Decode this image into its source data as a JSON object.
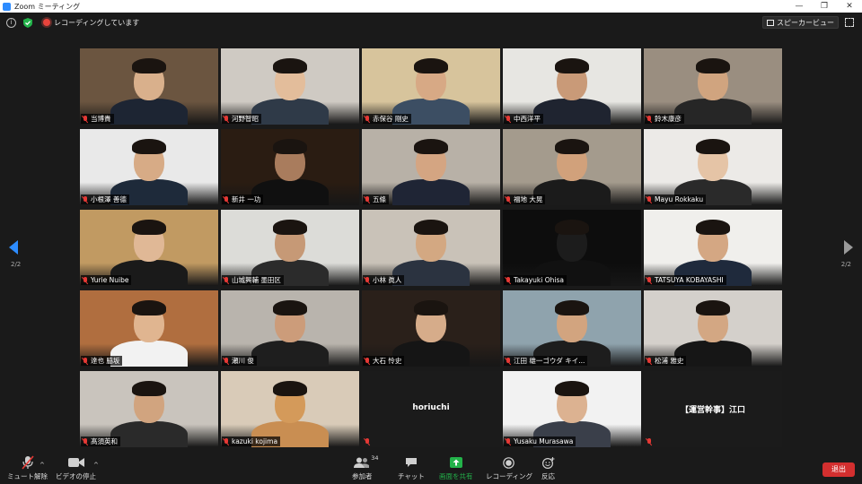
{
  "window": {
    "title": "Zoom ミーティング",
    "controls": [
      "—",
      "❐",
      "✕"
    ]
  },
  "topbar": {
    "recording_text": "レコーディングしています",
    "view_button": "スピーカービュー"
  },
  "pagination": {
    "left": "2/2",
    "right": "2/2"
  },
  "colors": {
    "accent": "#2d8cff",
    "leave": "#d32f2f",
    "muted": "#e53935"
  },
  "tiles": [
    {
      "name": "当博貴",
      "muted": true,
      "bg": "#6b5540",
      "skin": "#d9b08c",
      "suit": "#1d2533"
    },
    {
      "name": "河野智昭",
      "muted": true,
      "bg": "#cfcac3",
      "skin": "#e3bd9b",
      "suit": "#2f3a48"
    },
    {
      "name": "赤保谷 剛史",
      "muted": true,
      "bg": "#d7c49c",
      "skin": "#d7a985",
      "suit": "#3c4e63"
    },
    {
      "name": "中西洋平",
      "muted": true,
      "bg": "#e7e6e2",
      "skin": "#c99a78",
      "suit": "#1f2430"
    },
    {
      "name": "鈴木康彦",
      "muted": true,
      "bg": "#9a8e80",
      "skin": "#d0a47f",
      "suit": "#262626"
    },
    {
      "name": "小根澤 善德",
      "muted": true,
      "bg": "#e9e9e9",
      "skin": "#d7ab86",
      "suit": "#1e2a3a"
    },
    {
      "name": "新井 一功",
      "muted": true,
      "bg": "#2a1c12",
      "skin": "#a97c5d",
      "suit": "#101010"
    },
    {
      "name": "五條",
      "muted": true,
      "bg": "#b8b1a7",
      "skin": "#d4a582",
      "suit": "#1f2535"
    },
    {
      "name": "福地 大晃",
      "muted": true,
      "bg": "#a49b8d",
      "skin": "#d1a17b",
      "suit": "#1b1b1b"
    },
    {
      "name": "Mayu Rokkaku",
      "muted": true,
      "bg": "#eceae7",
      "skin": "#e5c4a6",
      "suit": "#2a2a2a"
    },
    {
      "name": "Yurie Nuibe",
      "muted": true,
      "bg": "#c19a62",
      "skin": "#e0b896",
      "suit": "#1a1a1a"
    },
    {
      "name": "山城興輔 墨田区",
      "muted": true,
      "bg": "#dcdcd8",
      "skin": "#c69976",
      "suit": "#2b2b2b"
    },
    {
      "name": "小林 眞人",
      "muted": true,
      "bg": "#c9c2b8",
      "skin": "#d3a882",
      "suit": "#2b3340"
    },
    {
      "name": "Takayuki Ohisa",
      "muted": true,
      "bg": "#0d0d0d",
      "skin": "#1c1c1c",
      "suit": "#111111"
    },
    {
      "name": "TATSUYA KOBAYASHI",
      "muted": true,
      "bg": "#f0efec",
      "skin": "#d4a783",
      "suit": "#1f2a3c"
    },
    {
      "name": "達也 脇坂",
      "muted": true,
      "bg": "#b06e3f",
      "skin": "#e0b590",
      "suit": "#f2f2f2"
    },
    {
      "name": "瀬川 俊",
      "muted": true,
      "bg": "#b9b4ad",
      "skin": "#cc9c7a",
      "suit": "#1e1e1e"
    },
    {
      "name": "大石 怜史",
      "muted": true,
      "bg": "#2a201a",
      "skin": "#d6ac8a",
      "suit": "#151515"
    },
    {
      "name": "江田 雄一ゴウダ キイ...",
      "muted": true,
      "bg": "#8fa3ad",
      "skin": "#d2a47f",
      "suit": "#1d1d1d"
    },
    {
      "name": "松浦 雅史",
      "muted": true,
      "bg": "#d4d0cb",
      "skin": "#d3a783",
      "suit": "#161616"
    },
    {
      "name": "髙須英和",
      "muted": true,
      "bg": "#c9c4bd",
      "skin": "#d1a47f",
      "suit": "#2a2a2a"
    },
    {
      "name": "kazuki kojima",
      "muted": true,
      "bg": "#d9cbb8",
      "skin": "#d49a5a",
      "suit": "#c98e52"
    },
    {
      "name": "",
      "muted": true,
      "center_name": "horiuchi"
    },
    {
      "name": "Yusaku Murasawa",
      "muted": true,
      "bg": "#f2f2f2",
      "skin": "#dcb291",
      "suit": "#3a3f4a"
    },
    {
      "name": "",
      "muted": true,
      "center_name": "【運営幹事】江口"
    }
  ],
  "toolbar": {
    "unmute": "ミュート解除",
    "stop_video": "ビデオの停止",
    "participants": "参加者",
    "participants_count": "34",
    "chat": "チャット",
    "share_screen": "画面を共有",
    "record": "レコーディング",
    "reactions": "反応",
    "leave": "退出"
  }
}
